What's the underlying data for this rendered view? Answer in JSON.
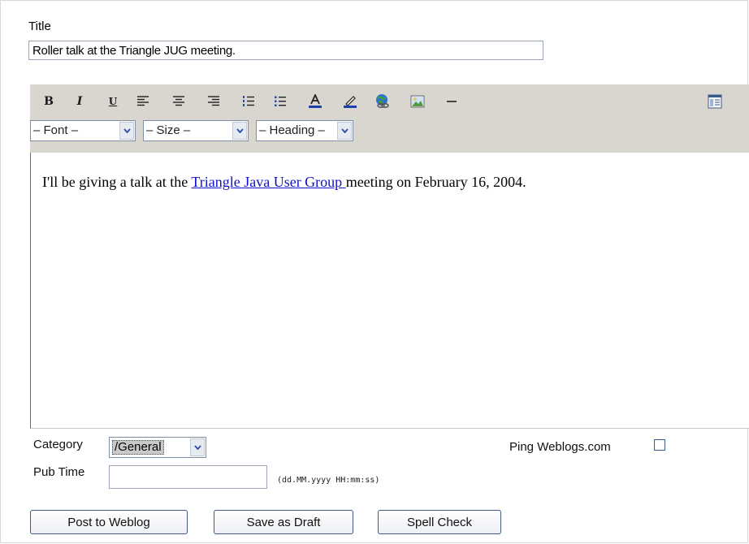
{
  "form": {
    "title_label": "Title",
    "title_value": "Roller talk at the Triangle JUG meeting."
  },
  "toolbar": {
    "buttons": [
      {
        "name": "bold",
        "glyph": "B",
        "icon": "bold-icon"
      },
      {
        "name": "italic",
        "glyph": "I",
        "icon": "italic-icon"
      },
      {
        "name": "underline",
        "glyph": "U",
        "icon": "underline-icon"
      },
      {
        "name": "align-left",
        "icon": "align-left-icon"
      },
      {
        "name": "align-center",
        "icon": "align-center-icon"
      },
      {
        "name": "align-right",
        "icon": "align-right-icon"
      },
      {
        "name": "ordered-list",
        "icon": "ordered-list-icon"
      },
      {
        "name": "unordered-list",
        "icon": "unordered-list-icon"
      },
      {
        "name": "font-color",
        "icon": "font-color-icon"
      },
      {
        "name": "highlight",
        "icon": "highlight-icon"
      },
      {
        "name": "insert-link",
        "icon": "globe-link-icon"
      },
      {
        "name": "insert-image",
        "icon": "image-icon"
      },
      {
        "name": "horizontal-rule",
        "icon": "horizontal-rule-icon"
      },
      {
        "name": "view-source",
        "icon": "view-source-icon"
      }
    ],
    "font_select": "– Font –",
    "size_select": "– Size –",
    "heading_select": "– Heading –"
  },
  "editor": {
    "text_before": "I'll be giving a talk at the ",
    "link_text": "Triangle Java User Group ",
    "text_after": "meeting on February 16, 2004."
  },
  "fields": {
    "category_label": "Category",
    "category_value": "/General",
    "pubtime_label": "Pub Time",
    "pubtime_value": "",
    "pubtime_hint": "(dd.MM.yyyy HH:mm:ss)",
    "ping_label": "Ping Weblogs.com",
    "ping_checked": false
  },
  "actions": {
    "post": "Post to Weblog",
    "draft": "Save as Draft",
    "spell": "Spell Check"
  },
  "colors": {
    "toolbar_bg": "#d9d6d0",
    "link": "#1010c8",
    "button_border": "#3f5a86"
  }
}
